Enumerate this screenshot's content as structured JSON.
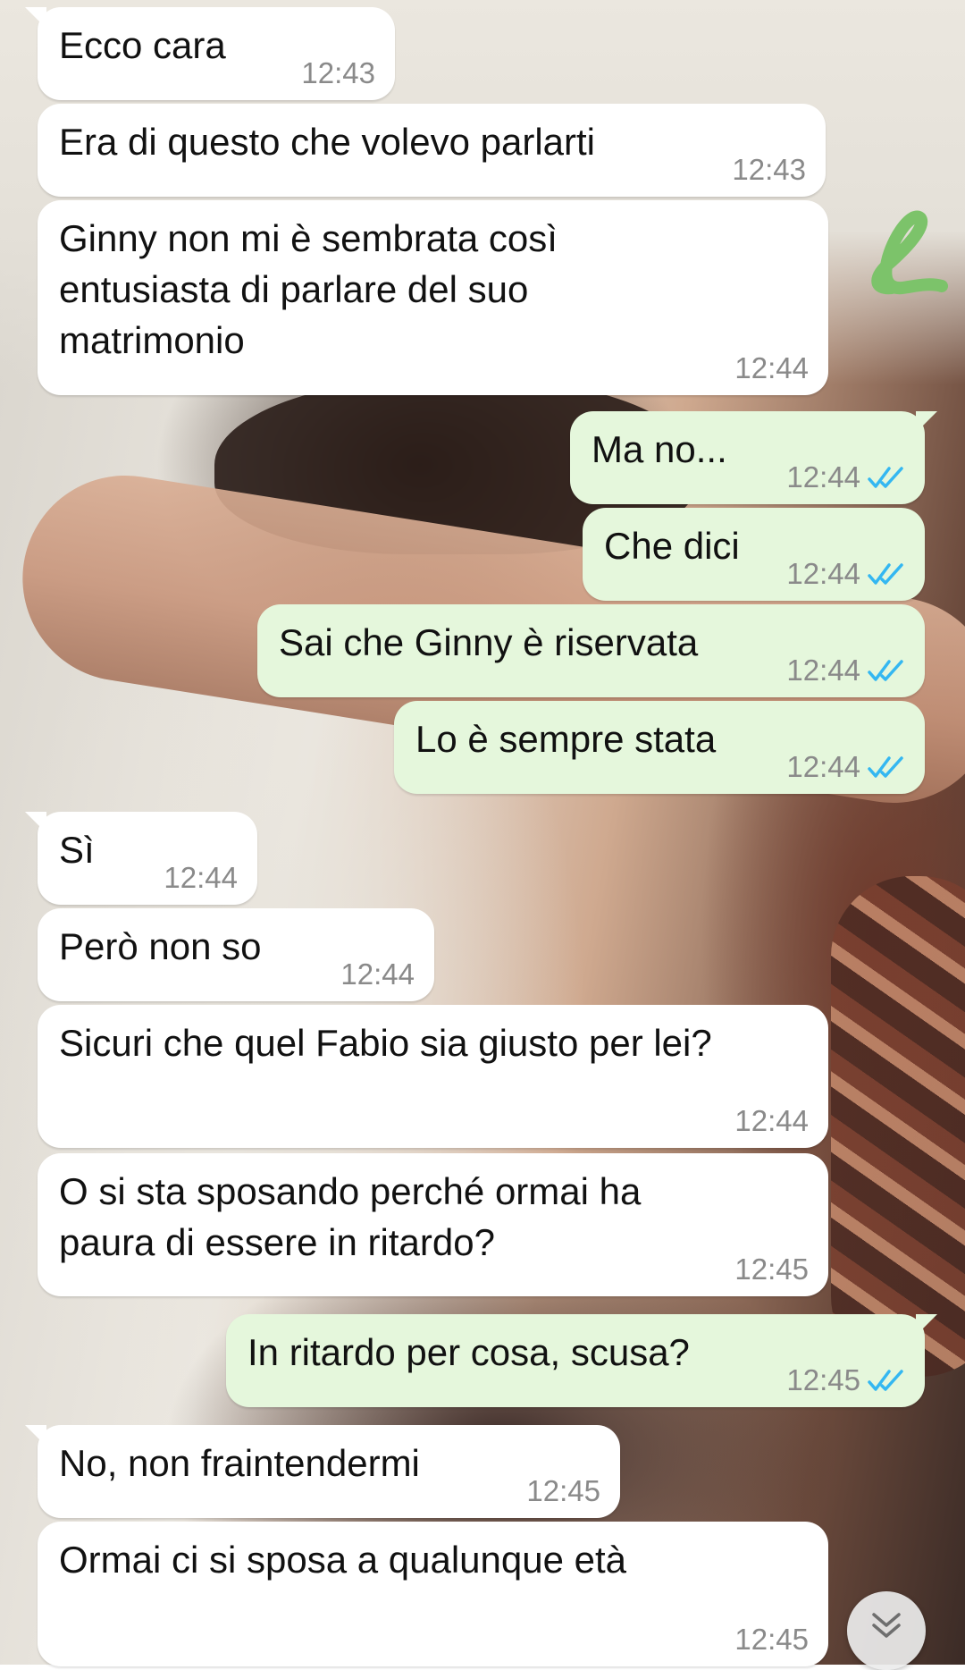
{
  "theme": {
    "incoming_bubble": "#ffffff",
    "outgoing_bubble": "#e5f7dc",
    "read_ticks": "#34b7f1",
    "timestamp": "#8a8a8a",
    "sticker_color": "#7cc36a"
  },
  "sticker": {
    "text": "l"
  },
  "messages": [
    {
      "text": "Ecco cara",
      "time": "12:43"
    },
    {
      "text": "Era di questo che volevo parlarti",
      "time": "12:43"
    },
    {
      "text": "Ginny non mi è sembrata così\nentusiasta di parlare del suo\nmatrimonio",
      "time": "12:44"
    },
    {
      "text": "Ma no...",
      "time": "12:44"
    },
    {
      "text": "Che dici",
      "time": "12:44"
    },
    {
      "text": "Sai che Ginny è riservata",
      "time": "12:44"
    },
    {
      "text": "Lo è sempre stata",
      "time": "12:44"
    },
    {
      "text": "Sì",
      "time": "12:44"
    },
    {
      "text": "Però non so",
      "time": "12:44"
    },
    {
      "text": "Sicuri che quel Fabio sia giusto per lei?",
      "time": "12:44"
    },
    {
      "text": "O si sta sposando perché ormai ha\npaura di essere in ritardo?",
      "time": "12:45"
    },
    {
      "text": "In ritardo per cosa, scusa?",
      "time": "12:45"
    },
    {
      "text": "No, non fraintendermi",
      "time": "12:45"
    },
    {
      "text": "Ormai ci si sposa a qualunque età",
      "time": "12:45"
    }
  ],
  "scroll_button": {
    "icon": "double-chevron-down-icon"
  }
}
